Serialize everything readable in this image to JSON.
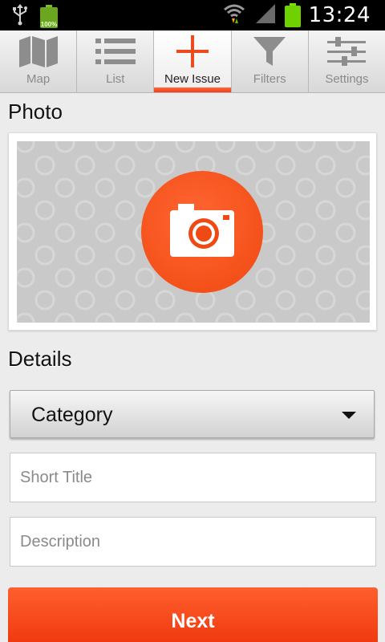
{
  "status_bar": {
    "time": "13:24",
    "battery_small_label": "100%"
  },
  "tabs": [
    {
      "label": "Map",
      "icon": "map-icon"
    },
    {
      "label": "List",
      "icon": "list-icon"
    },
    {
      "label": "New Issue",
      "icon": "plus-icon",
      "active": true
    },
    {
      "label": "Filters",
      "icon": "filter-icon"
    },
    {
      "label": "Settings",
      "icon": "sliders-icon"
    }
  ],
  "photo": {
    "title": "Photo",
    "icon": "camera-icon"
  },
  "details": {
    "title": "Details",
    "category_value": "Category",
    "short_title_placeholder": "Short Title",
    "description_placeholder": "Description"
  },
  "actions": {
    "next_label": "Next"
  },
  "colors": {
    "accent": "#f4511e",
    "status_bar": "#000000",
    "battery": "#6fd200"
  }
}
